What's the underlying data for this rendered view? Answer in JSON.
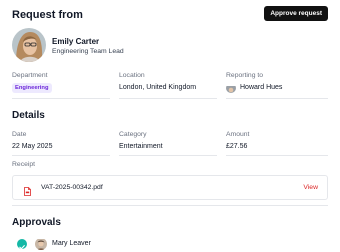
{
  "header": {
    "title": "Request from",
    "approve_button": "Approve request"
  },
  "requester": {
    "name": "Emily Carter",
    "role": "Engineering Team Lead"
  },
  "info": {
    "department_label": "Department",
    "department_value": "Engineering",
    "location_label": "Location",
    "location_value": "London, United Kingdom",
    "reporting_label": "Reporting to",
    "reporting_value": "Howard Hues"
  },
  "details": {
    "title": "Details",
    "date_label": "Date",
    "date_value": "22 May 2025",
    "category_label": "Category",
    "category_value": "Entertainment",
    "amount_label": "Amount",
    "amount_value": "£27.56",
    "receipt_label": "Receipt",
    "receipt_file": "VAT-2025-00342.pdf",
    "receipt_view": "View"
  },
  "approvals": {
    "title": "Approvals",
    "items": [
      {
        "name": "Mary Leaver",
        "status": "approved"
      }
    ]
  },
  "colors": {
    "button_bg": "#111111",
    "badge_text": "#6d28d9",
    "badge_bg": "#ede9fe",
    "link_red": "#dc2626",
    "check_teal": "#14b8a6"
  },
  "icons": {
    "file": "pdf-file-icon",
    "approved": "check-circle-icon"
  }
}
